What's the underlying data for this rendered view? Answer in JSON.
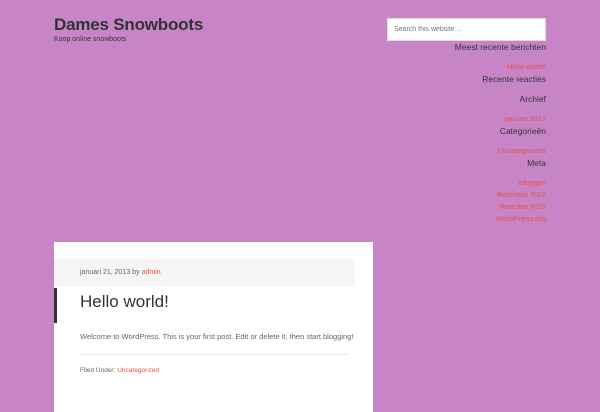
{
  "header": {
    "title": "Dames Snowboots",
    "description": "Koop online snowboots"
  },
  "search": {
    "placeholder": "Search this website…"
  },
  "sidebar": {
    "recent_posts_title": "Meest recente berichten",
    "recent_posts": [
      "Hello world!"
    ],
    "recent_comments_title": "Recente reacties",
    "archive_title": "Archief",
    "archive_items": [
      "januari 2013"
    ],
    "categories_title": "Categorieën",
    "categories": [
      "Uncategorized"
    ],
    "meta_title": "Meta",
    "meta_links": [
      "Inloggen",
      "Berichten RSS",
      "Reacties RSS",
      "WordPress.org"
    ]
  },
  "post": {
    "date": "januari 21, 2013",
    "by": "by",
    "author": "admin",
    "title": "Hello world!",
    "content": "Welcome to WordPress. This is your first post. Edit or delete it, then start blogging!",
    "filed_under_label": "Filed Under:",
    "category": "Uncategorized"
  },
  "colors": {
    "background": "#c785c8",
    "link": "#e5534b",
    "text": "#333333"
  }
}
